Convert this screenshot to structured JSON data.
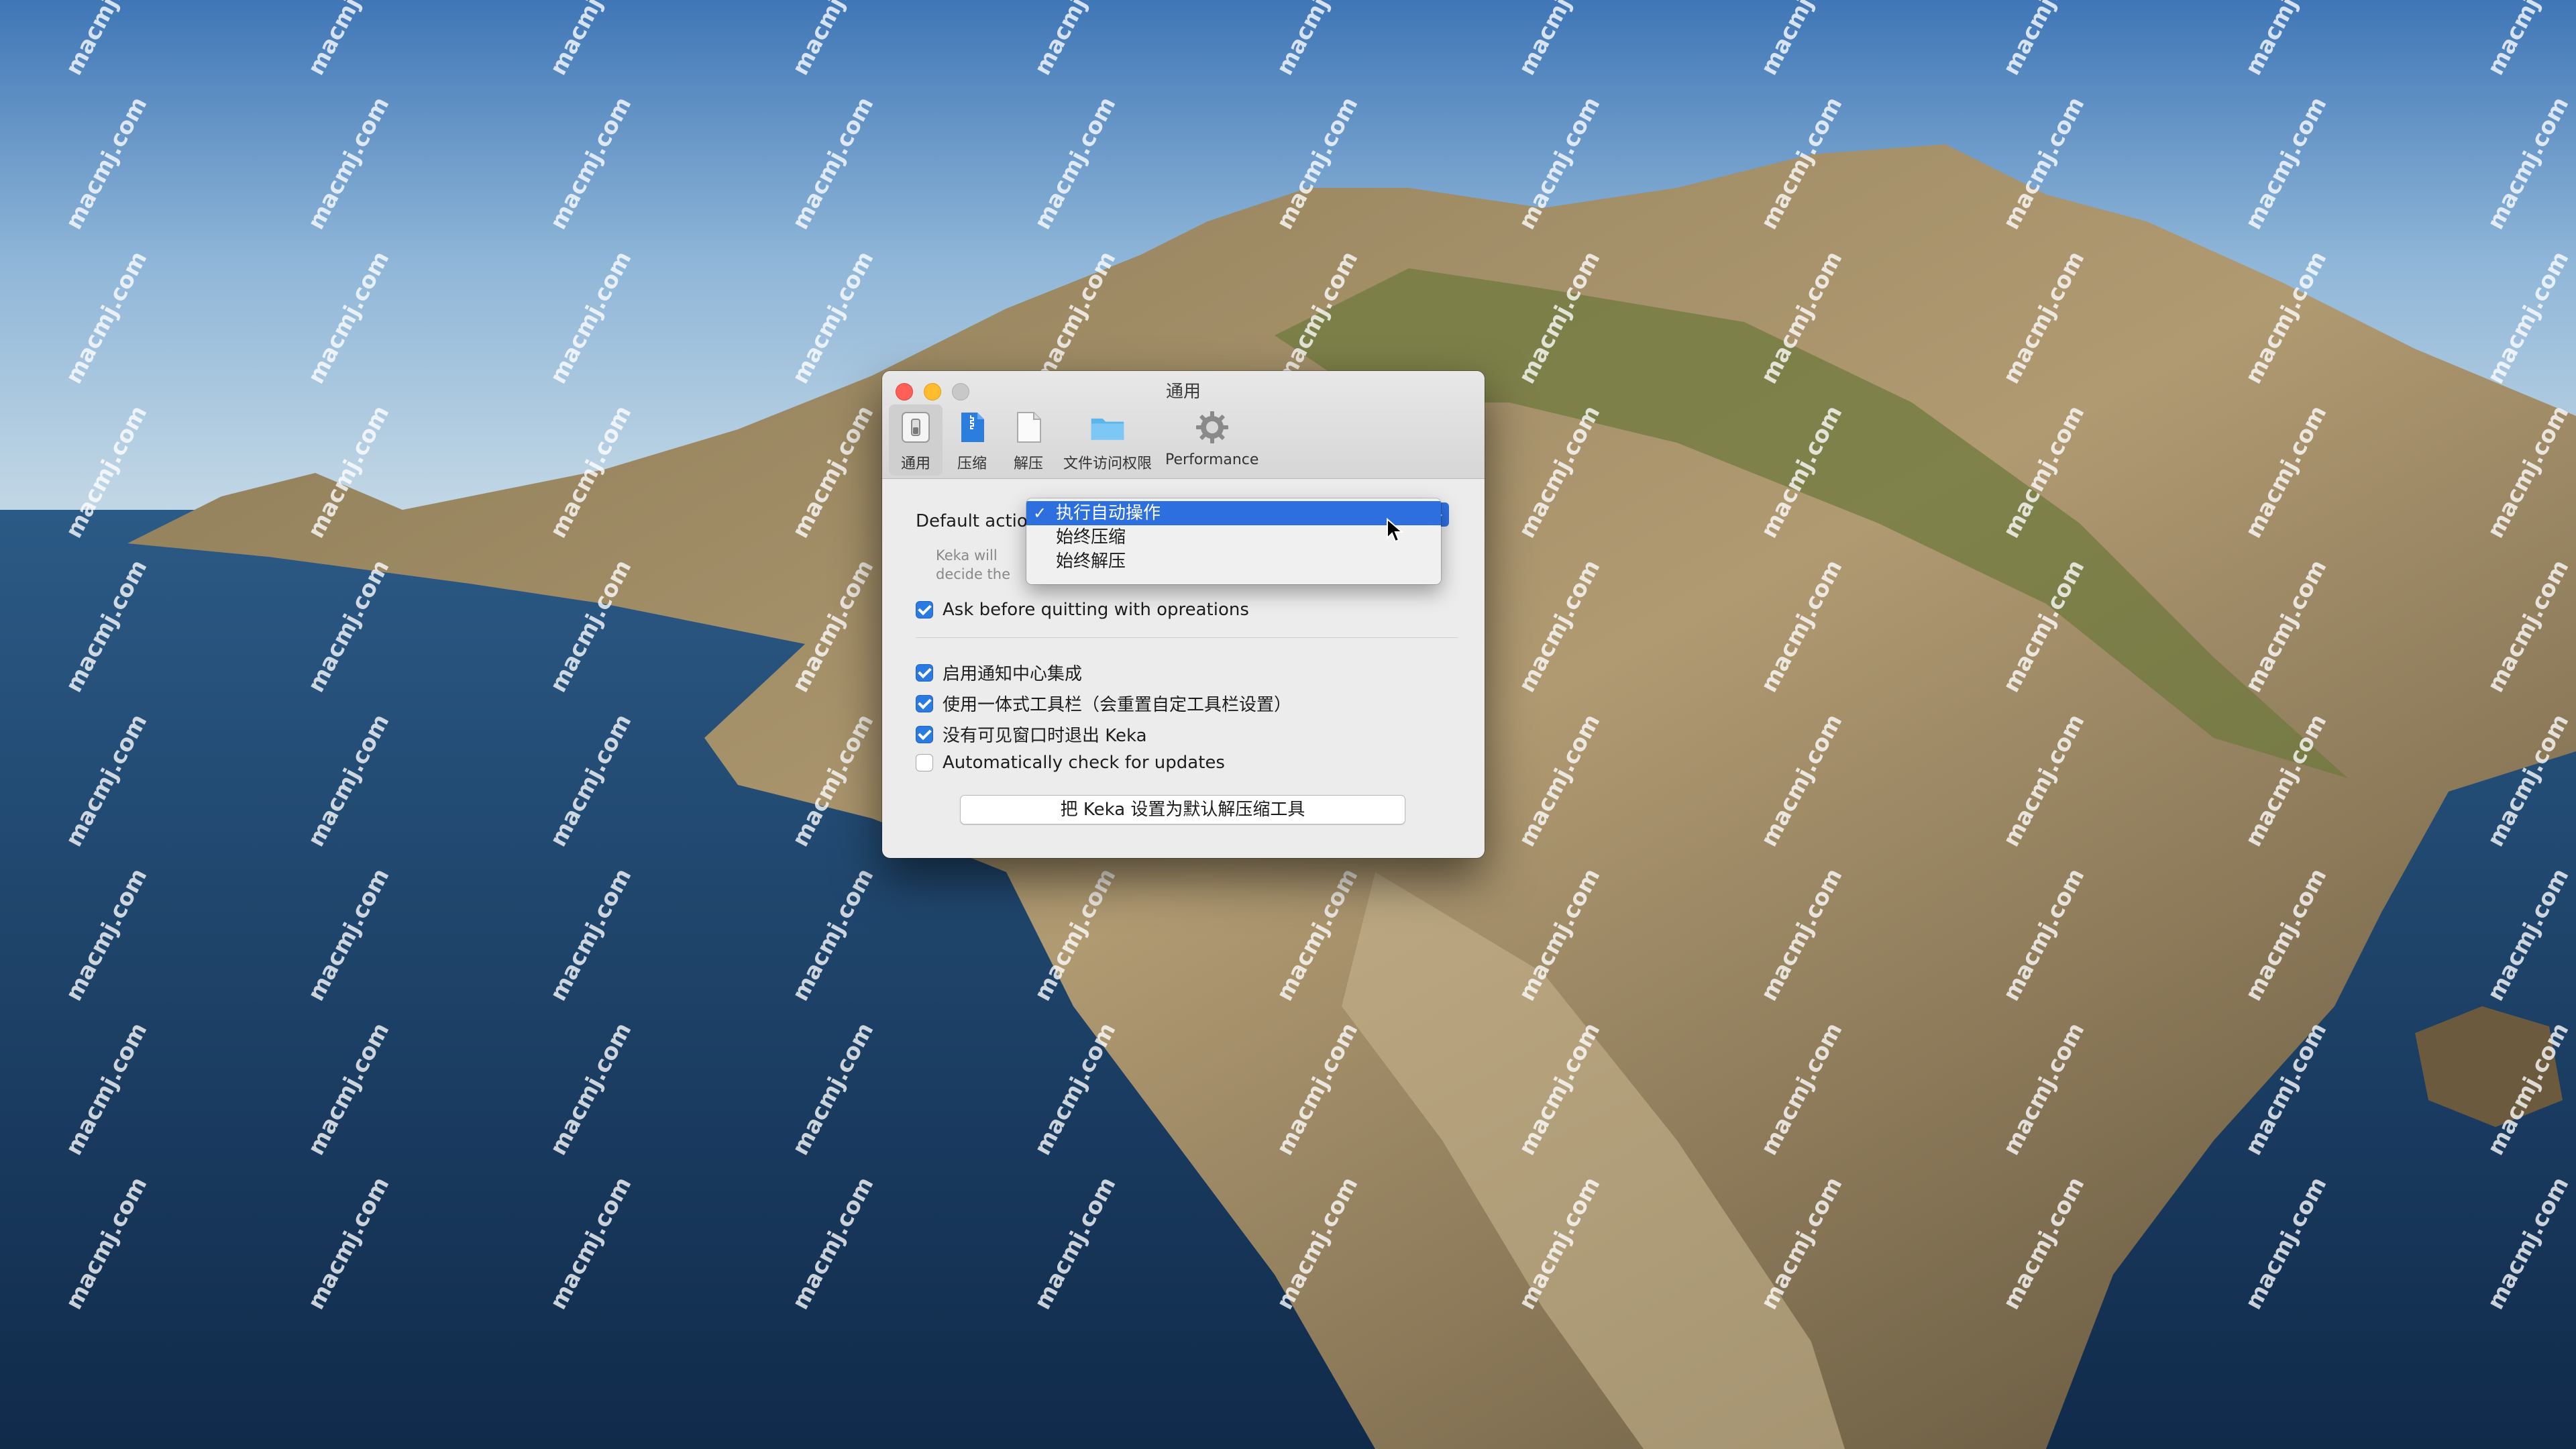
{
  "window": {
    "title": "通用",
    "toolbar": [
      {
        "label": "通用",
        "icon": "general-switch-icon",
        "selected": true
      },
      {
        "label": "压缩",
        "icon": "compress-icon",
        "selected": false
      },
      {
        "label": "解压",
        "icon": "extract-icon",
        "selected": false
      },
      {
        "label": "文件访问权限",
        "icon": "folder-icon",
        "selected": false
      },
      {
        "label": "Performance",
        "icon": "gear-icon",
        "selected": false
      }
    ]
  },
  "general": {
    "default_action_label": "Default action:",
    "description": "Keka will decide the format and extract…",
    "ask_before_quitting": {
      "label": "Ask before quitting with opreations",
      "checked": true
    },
    "notification_center": {
      "label": "启用通知中心集成",
      "checked": true
    },
    "unified_toolbar": {
      "label": "使用一体式工具栏（会重置自定工具栏设置）",
      "checked": true
    },
    "quit_no_windows": {
      "label": "没有可见窗口时退出 Keka",
      "checked": true
    },
    "auto_update": {
      "label": "Automatically check for updates",
      "checked": false
    },
    "set_default_button": "把 Keka 设置为默认解压缩工具"
  },
  "dropdown": {
    "check_mark": "✓",
    "options": [
      "执行自动操作",
      "始终压缩",
      "始终解压"
    ],
    "selected": "执行自动操作",
    "arrow_glyph": "›"
  },
  "watermark": {
    "text": "macmj.com"
  },
  "colors": {
    "accent": "#2e6fe0",
    "checkbox": "#2a7ae2",
    "close": "#fe5f57",
    "minimize": "#febc2e"
  }
}
